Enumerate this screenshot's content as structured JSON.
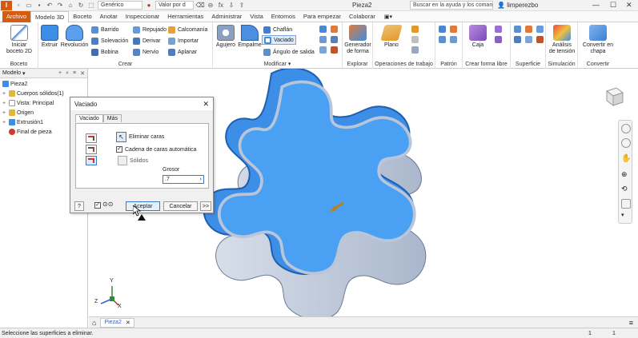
{
  "titlebar": {
    "material": "Genérico",
    "appearance": "Valor por d",
    "title": "Pieza2",
    "search_placeholder": "Buscar en la ayuda y los comand",
    "user": "limperezbo"
  },
  "tabs": [
    "Archivo",
    "Modelo 3D",
    "Boceto",
    "Anotar",
    "Inspeccionar",
    "Herramientas",
    "Administrar",
    "Vista",
    "Entornos",
    "Para empezar",
    "Colaborar"
  ],
  "ribbon": {
    "boceto": {
      "start_label_1": "Iniciar",
      "start_label_2": "boceto 2D",
      "group": "Boceto"
    },
    "crear": {
      "extruir": "Extruir",
      "revolucion": "Revolución",
      "barrido": "Barrido",
      "solevacion": "Solevación",
      "bobina": "Bobina",
      "repujado": "Repujado",
      "derivar": "Derivar",
      "nervio": "Nervio",
      "calcomania": "Calcomanía",
      "importar": "Importar",
      "aplanar": "Aplanar",
      "group": "Crear"
    },
    "modificar": {
      "agujero": "Agujero",
      "empalme": "Empalme",
      "chaflan": "Chaflán",
      "vaciado": "Vaciado",
      "angulo": "Ángulo de salida",
      "group": "Modificar"
    },
    "explorar": {
      "generador_1": "Generador",
      "generador_2": "de forma",
      "group": "Explorar"
    },
    "operaciones": {
      "plano": "Plano",
      "group": "Operaciones de trabajo"
    },
    "patron": {
      "group": "Patrón"
    },
    "forma_libre": {
      "caja": "Caja",
      "group": "Crear forma libre"
    },
    "superficie": {
      "group": "Superficie"
    },
    "simulacion": {
      "label_1": "Análisis",
      "label_2": "de tensión",
      "group": "Simulación"
    },
    "convertir": {
      "label_1": "Convertir en",
      "label_2": "chapa",
      "group": "Convertir"
    }
  },
  "browser": {
    "header": "Modelo",
    "items": [
      {
        "label": "Pieza2"
      },
      {
        "label": "Cuerpos sólidos(1)"
      },
      {
        "label": "Vista: Principal"
      },
      {
        "label": "Origen"
      },
      {
        "label": "Extrusión1"
      },
      {
        "label": "Final de pieza"
      }
    ]
  },
  "dialog": {
    "title": "Vaciado",
    "tab_vaciado": "Vaciado",
    "tab_mas": "Más",
    "eliminar_caras": "Eliminar caras",
    "cadena": "Cadena de caras automática",
    "solidos": "Sólidos",
    "grosor_label": "Grosor",
    "grosor_value": ".7",
    "ok": "Aceptar",
    "cancel": "Cancelar",
    "more": ">>"
  },
  "doc_tabs": {
    "tab": "Pieza2"
  },
  "status": {
    "message": "Seleccione las superficies a eliminar.",
    "count_1": "1",
    "count_2": "1"
  },
  "triad": {
    "x": "X",
    "y": "Y",
    "z": "Z"
  },
  "colors": {
    "accent": "#d45b0f",
    "shell": "#3c8ee6",
    "wall": "#c9d3e6"
  }
}
